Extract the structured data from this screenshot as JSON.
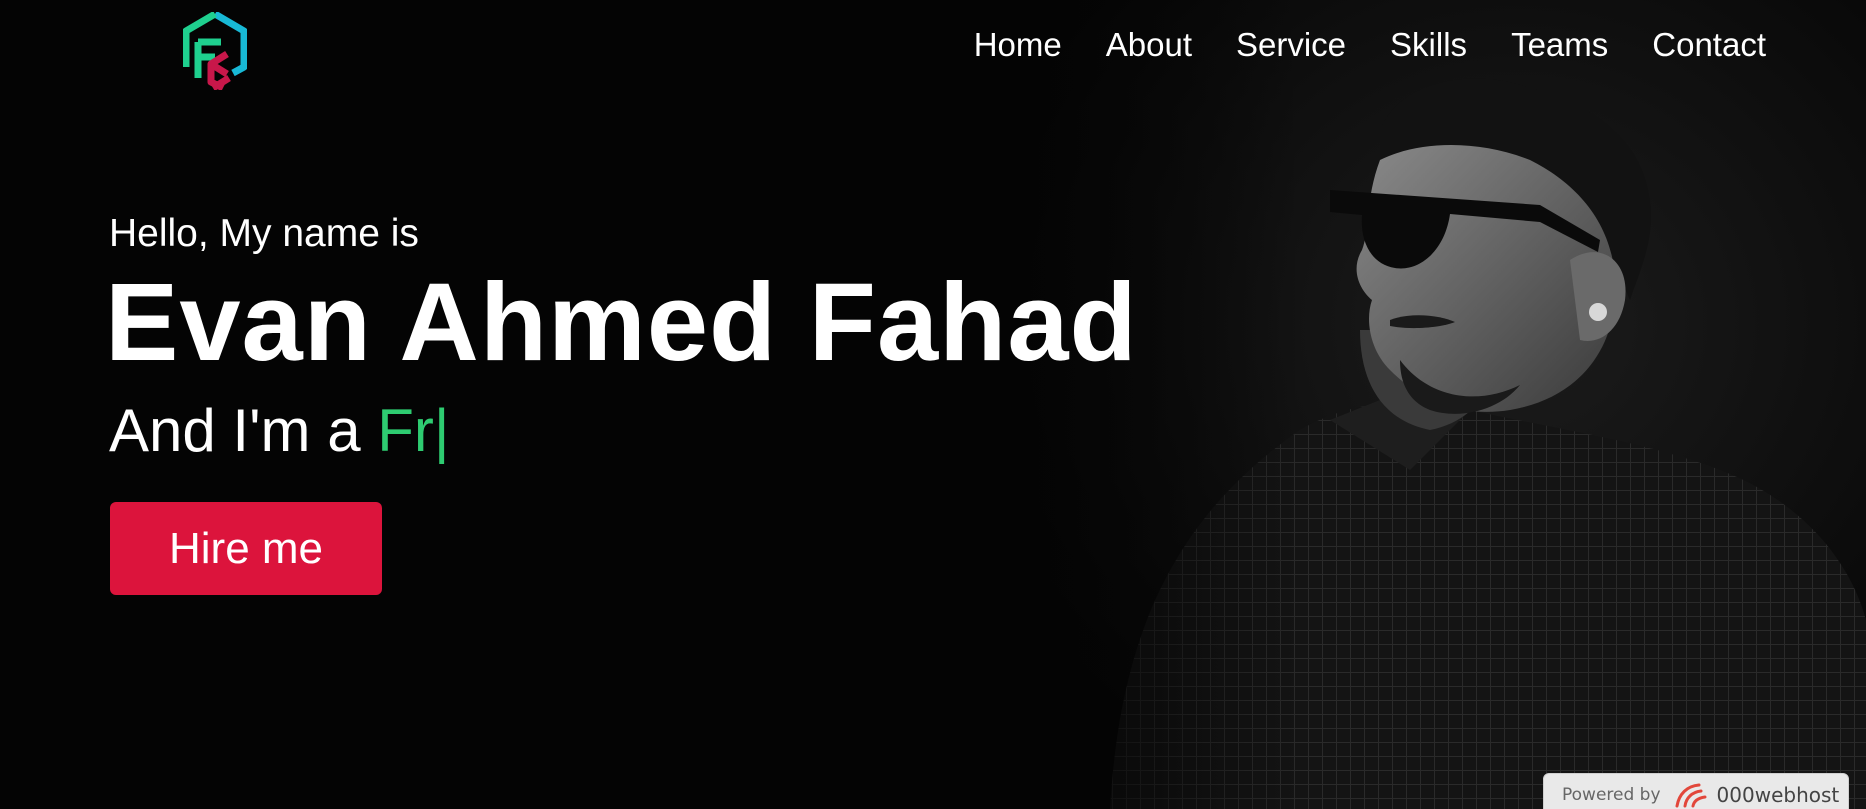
{
  "nav": {
    "items": [
      "Home",
      "About",
      "Service",
      "Skills",
      "Teams",
      "Contact"
    ]
  },
  "hero": {
    "intro": "Hello, My name is",
    "name": "Evan Ahmed Fahad",
    "role_prefix": "And I'm a ",
    "role_typed": "Fr",
    "cursor": "|",
    "hire_label": "Hire me"
  },
  "badge": {
    "powered": "Powered by",
    "brand": "000webhost"
  },
  "colors": {
    "background": "#040404",
    "accent_green": "#2ecc71",
    "button_red": "#dc143c",
    "text": "#ffffff"
  },
  "icons": {
    "logo": "fe-hexagon-logo",
    "brand": "000webhost-icon"
  }
}
